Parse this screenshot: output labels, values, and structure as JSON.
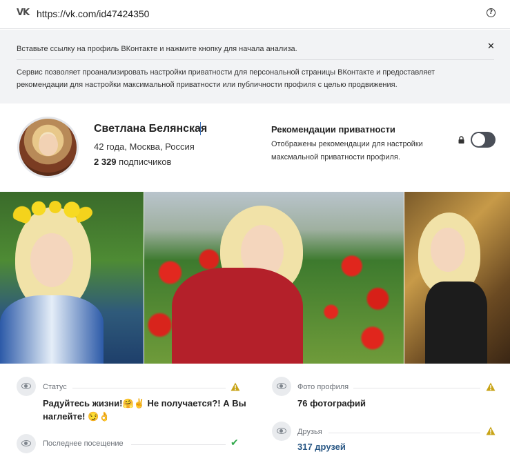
{
  "url_bar": {
    "icon": "vk-logo-icon",
    "url": "https://vk.com/id47424350",
    "help_icon": "question-circle-icon"
  },
  "info": {
    "line1": "Вставьте ссылку на профиль ВКонтакте и нажмите кнопку для начала анализа.",
    "line2": "Сервис позволяет проанализировать настройки приватности для персональной страницы ВКонтакте и предоставляет рекомендации для настройки максимальной приватности или публичности профиля с целью продвижения."
  },
  "profile": {
    "name": "Светлана Белянская",
    "meta": "42 года, Москва, Россия",
    "followers_count": "2 329",
    "followers_label": "подписчиков"
  },
  "recommendations": {
    "title": "Рекомендации приватности",
    "description": "Отображены рекомендации для настройки максмальной приватности профиля.",
    "toggle_on": false
  },
  "cards": {
    "status": {
      "label": "Статус",
      "value": "Радуйтесь жизни!🤗✌ Не получается?! А Вы наглейте! 😏👌",
      "indicator": "warning"
    },
    "last_seen": {
      "label": "Последнее посещение",
      "indicator": "ok"
    },
    "profile_photos": {
      "label": "Фото профиля",
      "value": "76 фотографий",
      "indicator": "warning"
    },
    "friends": {
      "label": "Друзья",
      "value": "317 друзей",
      "indicator": "warning"
    }
  },
  "colors": {
    "warning": "#c8a418",
    "ok": "#2fa84a",
    "link": "#2a5885",
    "panel_bg": "#f2f3f5"
  }
}
